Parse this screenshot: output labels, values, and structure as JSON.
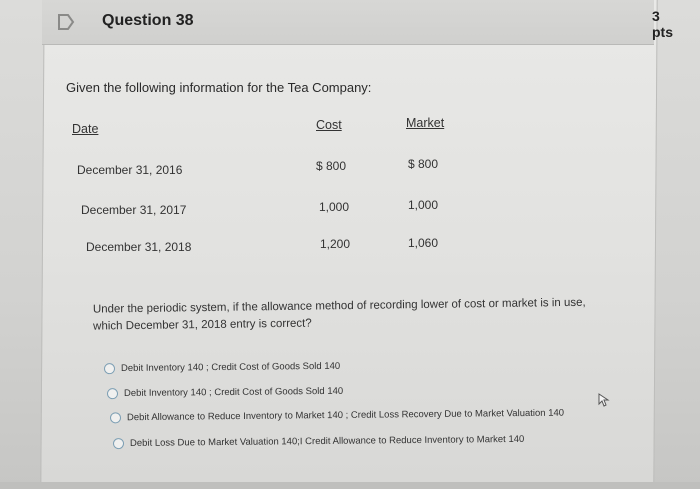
{
  "question": {
    "title": "Question 38",
    "points": "3 pts",
    "intro": "Given the following information for the Tea Company:"
  },
  "table": {
    "headers": [
      "Date",
      "Cost",
      "Market"
    ],
    "rows": [
      [
        "December 31, 2016",
        "$ 800",
        "$ 800"
      ],
      [
        "December 31, 2017",
        "1,000",
        "1,000"
      ],
      [
        "December 31, 2018",
        "1,200",
        "1,060"
      ]
    ]
  },
  "prompt": "Under the periodic system, if the allowance method of recording lower of cost or market is in use, which December 31, 2018 entry is correct?",
  "options": [
    "Debit Inventory 140 ; Credit Cost of Goods Sold 140",
    "Debit Inventory 140 ; Credit Cost of Goods Sold 140",
    "Debit Allowance to Reduce Inventory to Market 140 ; Credit Loss Recovery Due to Market Valuation 140",
    "Debit Loss Due to Market Valuation 140;I Credit Allowance to Reduce Inventory to Market 140"
  ],
  "colors": {
    "flag": "#8a8a88",
    "radio_border": "#7d9fb4",
    "text": "#333333"
  },
  "icons": {
    "flag": "bookmark-flag-icon",
    "cursor": "mouse-pointer-icon"
  }
}
